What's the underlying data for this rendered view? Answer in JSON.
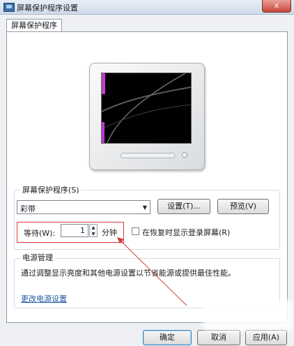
{
  "window": {
    "title": "屏幕保护程序设置",
    "close_label": "x"
  },
  "tab": {
    "label": "屏幕保护程序"
  },
  "screensaver": {
    "group_label": "屏幕保护程序(S)",
    "selected": "彩带",
    "settings_button": "设置(T)...",
    "preview_button": "预览(V)",
    "wait_label": "等待(W):",
    "wait_value": "1",
    "wait_unit": "分钟",
    "resume_checkbox_label": "在恢复时显示登录屏幕(R)",
    "resume_checked": false
  },
  "power": {
    "group_label": "电源管理",
    "description": "通过调整显示亮度和其他电源设置以节省能源或提供最佳性能。",
    "link": "更改电源设置"
  },
  "footer": {
    "ok": "确定",
    "cancel": "取消",
    "apply": "应用(A)"
  },
  "colors": {
    "annotation_red": "#d23a3a",
    "link_blue": "#1f5aa6"
  }
}
